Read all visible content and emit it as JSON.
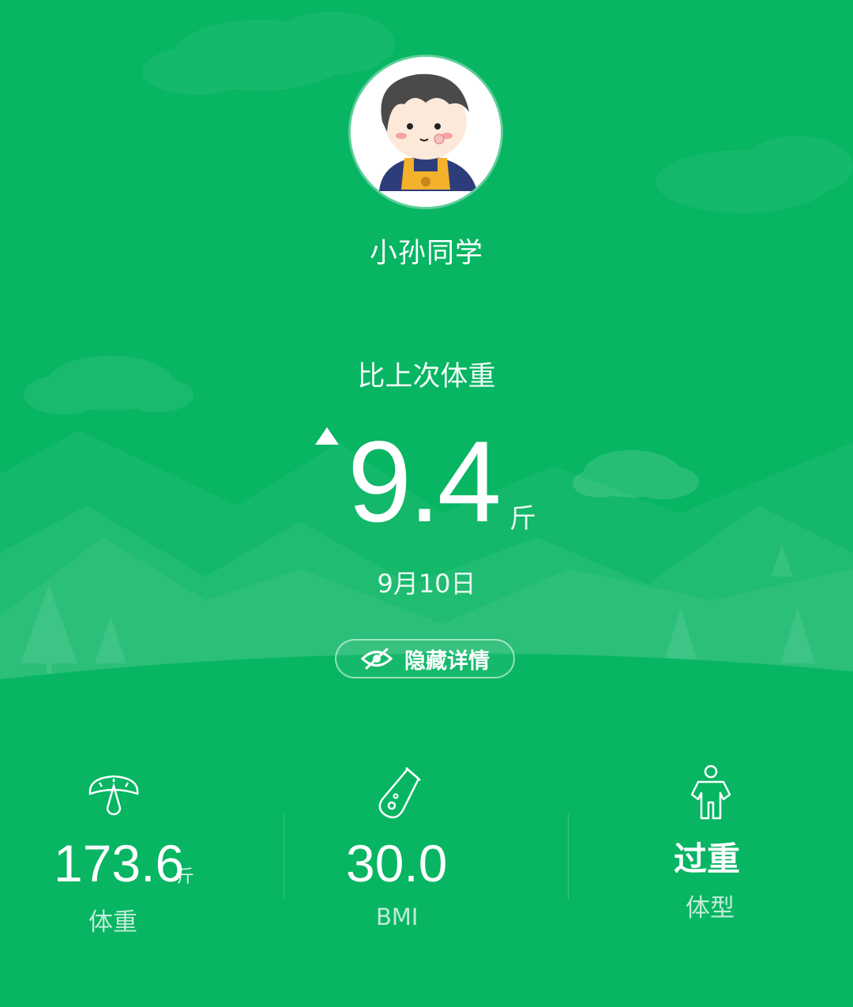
{
  "profile": {
    "name": "小孙同学"
  },
  "comparison": {
    "label": "比上次体重",
    "value": "9.4",
    "unit": "斤",
    "direction": "up",
    "date": "9月10日"
  },
  "hide_details_button": {
    "label": "隐藏详情",
    "icon": "eye-slash-icon"
  },
  "stats": [
    {
      "icon": "scale-icon",
      "value": "173.6",
      "unit": "斤",
      "label": "体重"
    },
    {
      "icon": "flask-icon",
      "value": "30.0",
      "label": "BMI"
    },
    {
      "icon": "person-icon",
      "value": "过重",
      "label": "体型"
    }
  ],
  "colors": {
    "background": "#07b563",
    "accent": "#f3b12c"
  }
}
